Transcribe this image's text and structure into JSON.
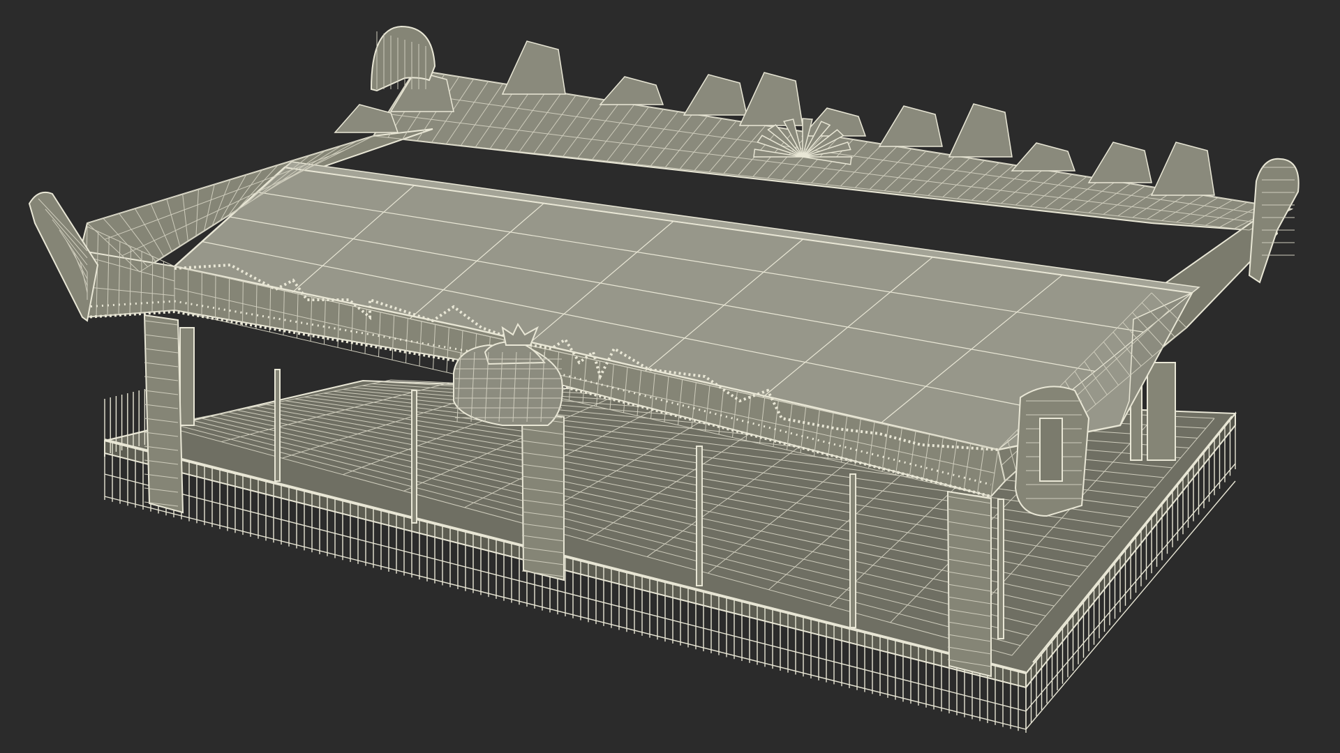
{
  "scene": {
    "subject": "",
    "colors": {
      "background": "#2b2b2b",
      "surface": "#858576",
      "surface_dark": "#6f6f63",
      "surface_light": "#97978a",
      "wire": "#e9e7d6",
      "wire_soft": "#cfcdbd"
    }
  }
}
